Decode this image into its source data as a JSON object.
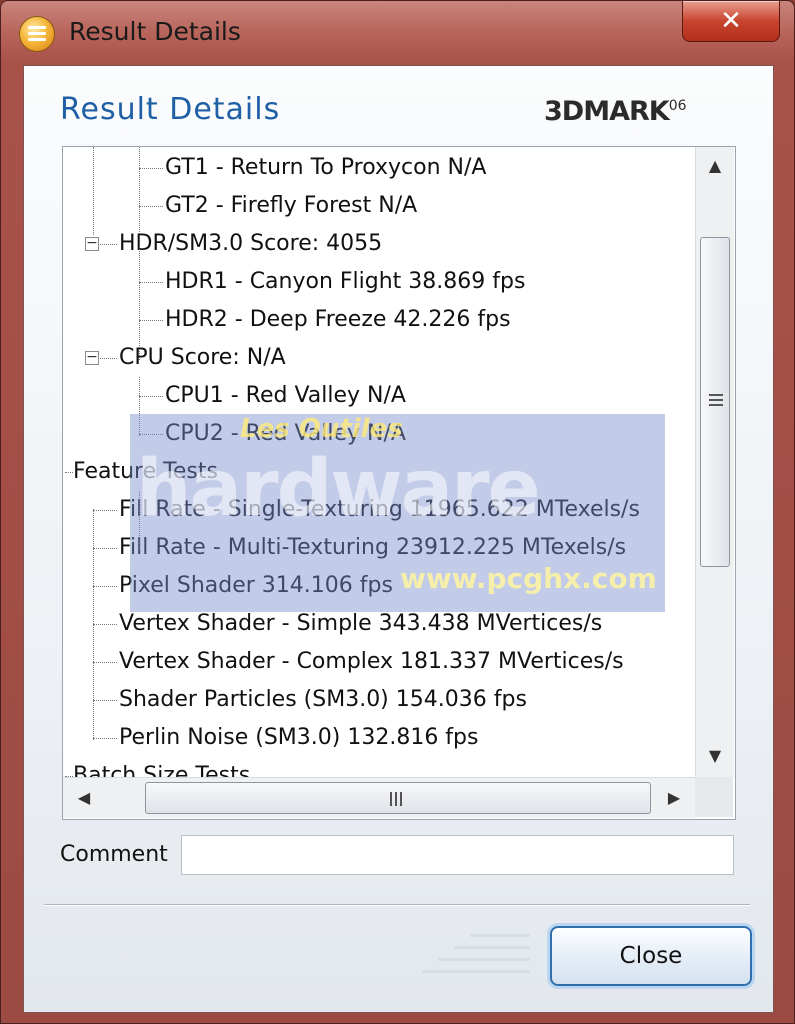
{
  "window": {
    "title": "Result Details",
    "close_glyph": "✕"
  },
  "header": {
    "title": "Result Details",
    "brand": "3DMARK",
    "brand_sup": "06"
  },
  "tree": {
    "rows": [
      {
        "text": "GT1 - Return To Proxycon   N/A",
        "level": 2
      },
      {
        "text": "GT2 - Firefly Forest   N/A",
        "level": 2
      },
      {
        "text": "HDR/SM3.0 Score: 4055",
        "level": 1,
        "expanded": true
      },
      {
        "text": "HDR1 - Canyon Flight   38.869 fps",
        "level": 2
      },
      {
        "text": "HDR2 - Deep Freeze   42.226 fps",
        "level": 2
      },
      {
        "text": "CPU Score: N/A",
        "level": 1,
        "expanded": true
      },
      {
        "text": "CPU1 - Red Valley   N/A",
        "level": 2
      },
      {
        "text": "CPU2 - Red Valley   N/A",
        "level": 2
      },
      {
        "text": "Feature Tests",
        "level": 0
      },
      {
        "text": "Fill Rate - Single-Texturing   11965.622 MTexels/s",
        "level": 1
      },
      {
        "text": "Fill Rate - Multi-Texturing   23912.225 MTexels/s",
        "level": 1
      },
      {
        "text": "Pixel Shader   314.106 fps",
        "level": 1
      },
      {
        "text": "Vertex Shader - Simple   343.438 MVertices/s",
        "level": 1
      },
      {
        "text": "Vertex Shader - Complex   181.337 MVertices/s",
        "level": 1
      },
      {
        "text": "Shader Particles (SM3.0)   154.036 fps",
        "level": 1
      },
      {
        "text": "Perlin Noise (SM3.0)   132.816 fps",
        "level": 1
      },
      {
        "text": "Batch Size Tests",
        "level": 0
      }
    ]
  },
  "scrollbars": {
    "up": "▲",
    "down": "▼",
    "left": "◀",
    "right": "▶"
  },
  "comment": {
    "label": "Comment",
    "value": ""
  },
  "buttons": {
    "close": "Close"
  },
  "watermark": {
    "small": "Les Outiles",
    "brand": "hardware",
    "url": "www.pcghx.com"
  },
  "icons": [
    "app-icon",
    "close-icon",
    "collapse-icon",
    "scroll-up-icon",
    "scroll-down-icon",
    "scroll-left-icon",
    "scroll-right-icon",
    "grip-icon"
  ],
  "colors": {
    "header_title": "#1f5fa6",
    "title_bar": "#b9665d",
    "close_button_border": "#2f6fb0"
  }
}
